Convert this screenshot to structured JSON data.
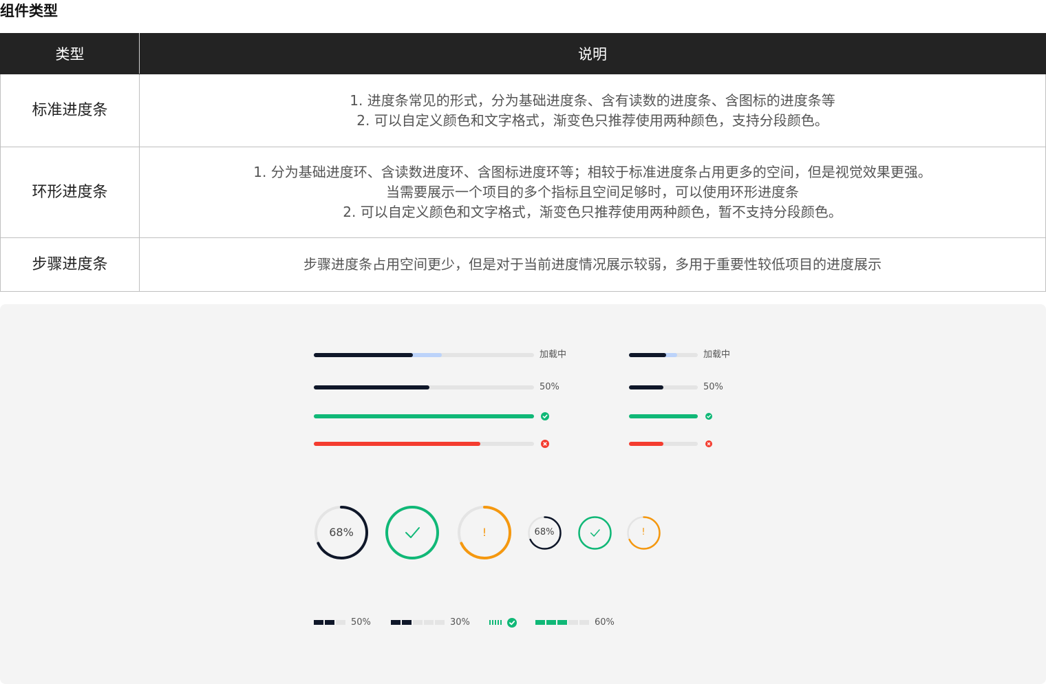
{
  "title": "组件类型",
  "table": {
    "headers": [
      "类型",
      "说明"
    ],
    "rows": [
      {
        "type": "标准进度条",
        "lines": [
          "1. 进度条常见的形式，分为基础进度条、含有读数的进度条、含图标的进度条等",
          "2. 可以自定义颜色和文字格式，渐变色只推荐使用两种颜色，支持分段颜色。"
        ]
      },
      {
        "type": "环形进度条",
        "lines": [
          "1. 分为基础进度环、含读数进度环、含图标进度环等；相较于标准进度条占用更多的空间，但是视觉效果更强。",
          "当需要展示一个项目的多个指标且空间足够时，可以使用环形进度条",
          "2. 可以自定义颜色和文字格式，渐变色只推荐使用两种颜色，暂不支持分段颜色。"
        ]
      },
      {
        "type": "步骤进度条",
        "lines": [
          "步骤进度条占用空间更少，但是对于当前进度情况展示较弱，多用于重要性较低项目的进度展示"
        ]
      }
    ]
  },
  "colors": {
    "dark": "#0f1729",
    "buffer": "#bcd3fa",
    "success": "#10b877",
    "error": "#f43c2f",
    "warning": "#f5980f",
    "track": "#e4e4e4"
  },
  "bars": {
    "large": [
      {
        "progress": 0.45,
        "buffer": 0.58,
        "color": "dark",
        "label": "加载中"
      },
      {
        "progress": 0.525,
        "color": "dark",
        "label": "50%"
      },
      {
        "progress": 1.0,
        "color": "success",
        "icon": "check-circle-icon"
      },
      {
        "progress": 0.755,
        "color": "error",
        "icon": "error-circle-icon"
      }
    ],
    "small": [
      {
        "progress": 0.54,
        "buffer": 0.7,
        "color": "dark",
        "label": "加载中"
      },
      {
        "progress": 0.5,
        "color": "dark",
        "label": "50%"
      },
      {
        "progress": 1.0,
        "color": "success",
        "icon": "check-circle-icon"
      },
      {
        "progress": 0.5,
        "color": "error",
        "icon": "error-circle-icon"
      }
    ]
  },
  "rings": [
    {
      "size": "large",
      "progress": 0.68,
      "color": "dark",
      "text": "68%"
    },
    {
      "size": "large",
      "progress": 1.0,
      "color": "success",
      "icon": "check-icon"
    },
    {
      "size": "large",
      "progress": 0.68,
      "color": "warning",
      "text": "!"
    },
    {
      "size": "small",
      "progress": 0.68,
      "color": "dark",
      "text": "68%"
    },
    {
      "size": "small",
      "progress": 1.0,
      "color": "success",
      "icon": "check-icon"
    },
    {
      "size": "small",
      "progress": 0.68,
      "color": "warning",
      "text": "!"
    }
  ],
  "steps": [
    {
      "segments": 3,
      "filled": 2,
      "color": "dark",
      "label": "50%"
    },
    {
      "segments": 5,
      "filled": 2,
      "color": "dark",
      "label": "30%"
    },
    {
      "segments": 5,
      "filled": 5,
      "color": "success",
      "thin": true,
      "icon": "check-circle-icon"
    },
    {
      "segments": 5,
      "filled": 3,
      "color": "success",
      "label": "60%"
    }
  ]
}
